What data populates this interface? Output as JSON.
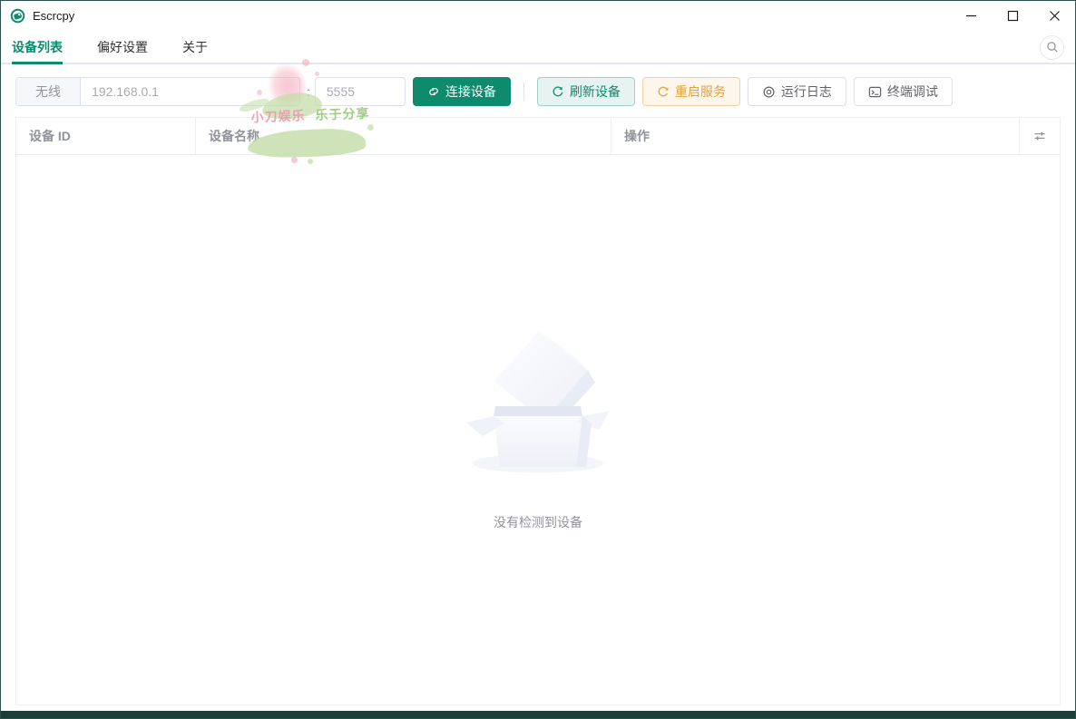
{
  "window": {
    "title": "Escrcpy"
  },
  "tabs": [
    {
      "label": "设备列表",
      "active": true
    },
    {
      "label": "偏好设置",
      "active": false
    },
    {
      "label": "关于",
      "active": false
    }
  ],
  "toolbar": {
    "mode_label": "无线",
    "ip_placeholder": "192.168.0.1",
    "separator": ":",
    "port_placeholder": "5555",
    "connect_label": "连接设备",
    "refresh_label": "刷新设备",
    "restart_label": "重启服务",
    "logs_label": "运行日志",
    "terminal_label": "终端调试"
  },
  "table": {
    "columns": [
      "设备 ID",
      "设备名称",
      "操作"
    ]
  },
  "empty": {
    "message": "没有检测到设备"
  },
  "watermark": {
    "text_left": "小刀娱乐",
    "text_right": "乐于分享"
  },
  "colors": {
    "primary": "#0e8a6d",
    "warning": "#e6a23c",
    "warning_bg": "#fdf6ec",
    "primary_plain_bg": "#e7f3f0",
    "frame": "#1c3e39",
    "table_border": "#ebeef5",
    "placeholder": "#a8abb2"
  },
  "icons": {
    "app": "escrcpy-logo",
    "minimize": "minimize-dash",
    "maximize": "maximize-square",
    "close": "close-x",
    "search": "magnifier",
    "connect": "link",
    "refresh": "refresh-cycle",
    "restart": "refresh-right",
    "logs": "view-eye",
    "terminal": "terminal-window",
    "column_settings": "sliders"
  }
}
